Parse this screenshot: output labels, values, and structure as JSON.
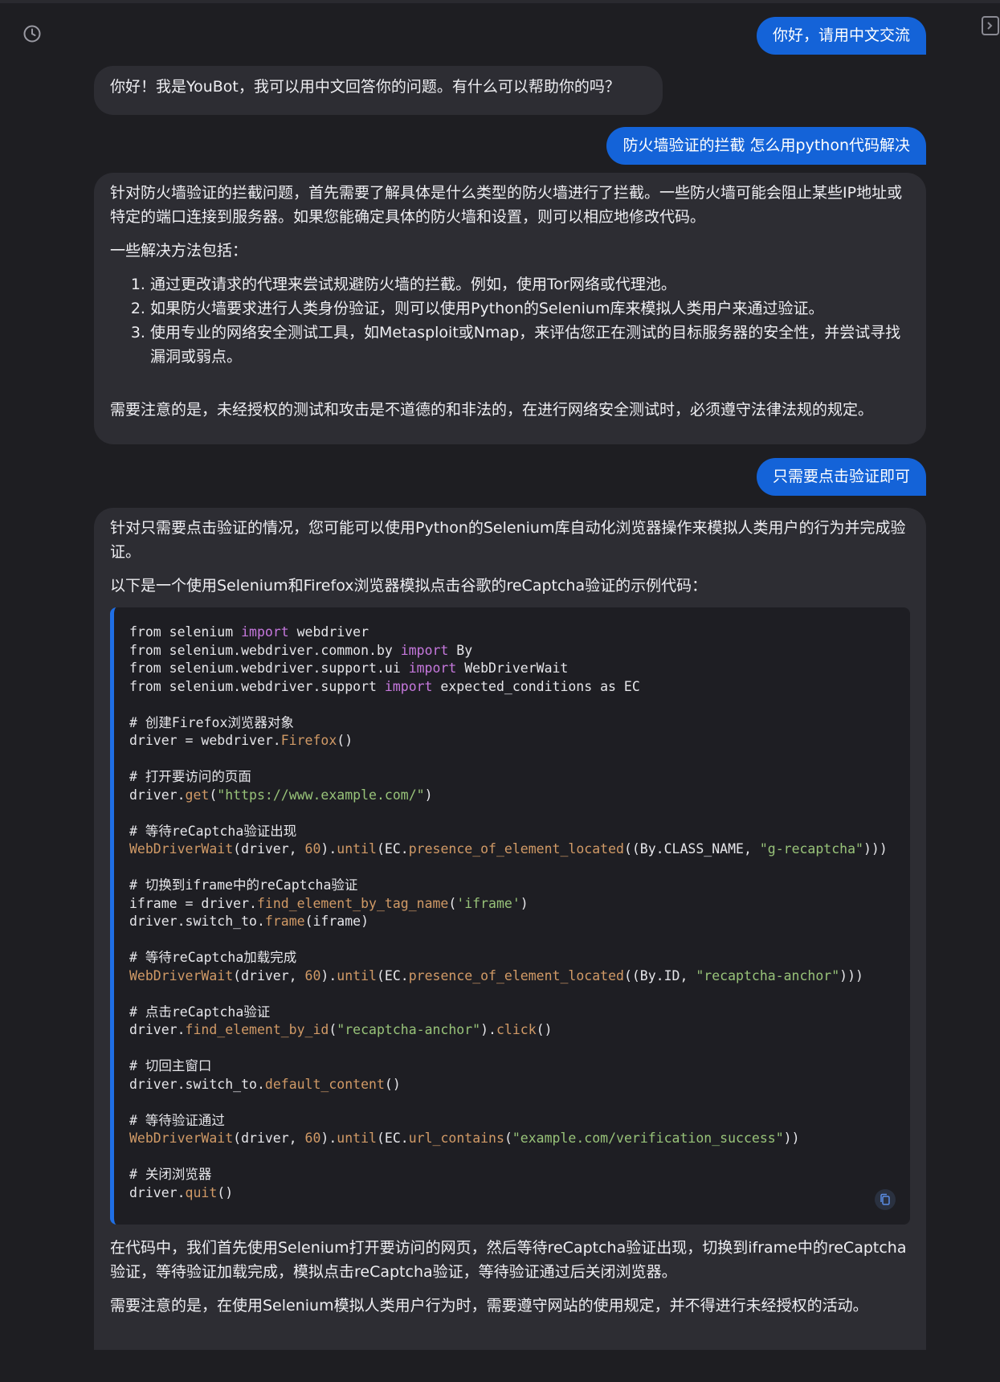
{
  "messages": [
    {
      "role": "user",
      "text": "你好，请用中文交流"
    },
    {
      "role": "bot",
      "paragraphs": [
        "你好！我是YouBot，我可以用中文回答你的问题。有什么可以帮助你的吗？"
      ]
    },
    {
      "role": "user",
      "text": "防火墙验证的拦截 怎么用python代码解决"
    },
    {
      "role": "bot",
      "intro": "针对防火墙验证的拦截问题，首先需要了解具体是什么类型的防火墙进行了拦截。一些防火墙可能会阻止某些IP地址或特定的端口连接到服务器。如果您能确定具体的防火墙和设置，则可以相应地修改代码。",
      "list_title": "一些解决方法包括：",
      "list": [
        "通过更改请求的代理来尝试规避防火墙的拦截。例如，使用Tor网络或代理池。",
        "如果防火墙要求进行人类身份验证，则可以使用Python的Selenium库来模拟人类用户来通过验证。",
        "使用专业的网络安全测试工具，如Metasploit或Nmap，来评估您正在测试的目标服务器的安全性，并尝试寻找漏洞或弱点。"
      ],
      "note": "需要注意的是，未经授权的测试和攻击是不道德的和非法的，在进行网络安全测试时，必须遵守法律法规的规定。"
    },
    {
      "role": "user",
      "text": "只需要点击验证即可"
    },
    {
      "role": "bot",
      "intro": "针对只需要点击验证的情况，您可能可以使用Python的Selenium库自动化浏览器操作来模拟人类用户的行为并完成验证。",
      "code_intro": "以下是一个使用Selenium和Firefox浏览器模拟点击谷歌的reCaptcha验证的示例代码：",
      "outro": "在代码中，我们首先使用Selenium打开要访问的网页，然后等待reCaptcha验证出现，切换到iframe中的reCaptcha验证，等待验证加载完成，模拟点击reCaptcha验证，等待验证通过后关闭浏览器。",
      "note": "需要注意的是，在使用Selenium模拟人类用户行为时，需要遵守网站的使用规定，并不得进行未经授权的活动。"
    }
  ],
  "code_lines": [
    [
      [
        "from selenium ",
        ""
      ],
      [
        "import",
        "kw"
      ],
      [
        " webdriver",
        ""
      ]
    ],
    [
      [
        "from selenium.webdriver.common.by ",
        ""
      ],
      [
        "import",
        "kw"
      ],
      [
        " By",
        ""
      ]
    ],
    [
      [
        "from selenium.webdriver.support.ui ",
        ""
      ],
      [
        "import",
        "kw"
      ],
      [
        " WebDriverWait",
        ""
      ]
    ],
    [
      [
        "from selenium.webdriver.support ",
        ""
      ],
      [
        "import",
        "kw"
      ],
      [
        " expected_conditions as EC",
        ""
      ]
    ],
    [],
    [
      [
        "# 创建Firefox浏览器对象",
        "cm"
      ]
    ],
    [
      [
        "driver = webdriver.",
        ""
      ],
      [
        "Firefox",
        "fn"
      ],
      [
        "()",
        ""
      ]
    ],
    [],
    [
      [
        "# 打开要访问的页面",
        "cm"
      ]
    ],
    [
      [
        "driver.",
        ""
      ],
      [
        "get",
        "fn"
      ],
      [
        "(",
        ""
      ],
      [
        "\"https://www.example.com/\"",
        "str"
      ],
      [
        ")",
        ""
      ]
    ],
    [],
    [
      [
        "# 等待reCaptcha验证出现",
        "cm"
      ]
    ],
    [
      [
        "WebDriverWait",
        "fn"
      ],
      [
        "(driver, ",
        ""
      ],
      [
        "60",
        "num"
      ],
      [
        ").",
        ""
      ],
      [
        "until",
        "fn"
      ],
      [
        "(EC.",
        ""
      ],
      [
        "presence_of_element_located",
        "fn"
      ],
      [
        "((By.CLASS_NAME, ",
        ""
      ],
      [
        "\"g-recaptcha\"",
        "str"
      ],
      [
        ")))",
        ""
      ]
    ],
    [],
    [
      [
        "# 切换到iframe中的reCaptcha验证",
        "cm"
      ]
    ],
    [
      [
        "iframe = driver.",
        ""
      ],
      [
        "find_element_by_tag_name",
        "fn"
      ],
      [
        "(",
        ""
      ],
      [
        "'iframe'",
        "str"
      ],
      [
        ")",
        ""
      ]
    ],
    [
      [
        "driver.switch_to.",
        ""
      ],
      [
        "frame",
        "fn"
      ],
      [
        "(iframe)",
        ""
      ]
    ],
    [],
    [
      [
        "# 等待reCaptcha加载完成",
        "cm"
      ]
    ],
    [
      [
        "WebDriverWait",
        "fn"
      ],
      [
        "(driver, ",
        ""
      ],
      [
        "60",
        "num"
      ],
      [
        ").",
        ""
      ],
      [
        "until",
        "fn"
      ],
      [
        "(EC.",
        ""
      ],
      [
        "presence_of_element_located",
        "fn"
      ],
      [
        "((By.ID, ",
        ""
      ],
      [
        "\"recaptcha-anchor\"",
        "str"
      ],
      [
        ")))",
        ""
      ]
    ],
    [],
    [
      [
        "# 点击reCaptcha验证",
        "cm"
      ]
    ],
    [
      [
        "driver.",
        ""
      ],
      [
        "find_element_by_id",
        "fn"
      ],
      [
        "(",
        ""
      ],
      [
        "\"recaptcha-anchor\"",
        "str"
      ],
      [
        ").",
        ""
      ],
      [
        "click",
        "fn"
      ],
      [
        "()",
        ""
      ]
    ],
    [],
    [
      [
        "# 切回主窗口",
        "cm"
      ]
    ],
    [
      [
        "driver.switch_to.",
        ""
      ],
      [
        "default_content",
        "fn"
      ],
      [
        "()",
        ""
      ]
    ],
    [],
    [
      [
        "# 等待验证通过",
        "cm"
      ]
    ],
    [
      [
        "WebDriverWait",
        "fn"
      ],
      [
        "(driver, ",
        ""
      ],
      [
        "60",
        "num"
      ],
      [
        ").",
        ""
      ],
      [
        "until",
        "fn"
      ],
      [
        "(EC.",
        ""
      ],
      [
        "url_contains",
        "fn"
      ],
      [
        "(",
        ""
      ],
      [
        "\"example.com/verification_success\"",
        "str"
      ],
      [
        "))",
        ""
      ]
    ],
    [],
    [
      [
        "# 关闭浏览器",
        "cm"
      ]
    ],
    [
      [
        "driver.",
        ""
      ],
      [
        "quit",
        "fn"
      ],
      [
        "()",
        ""
      ]
    ]
  ],
  "icons": {
    "history": "history-clock-icon",
    "panel": "sidebar-toggle-icon",
    "copy": "copy-icon"
  },
  "colors": {
    "user_bubble": "#1463d8",
    "bot_bubble": "#2d2d33",
    "background": "#1e1e22",
    "code_border": "#1f6fe6"
  }
}
